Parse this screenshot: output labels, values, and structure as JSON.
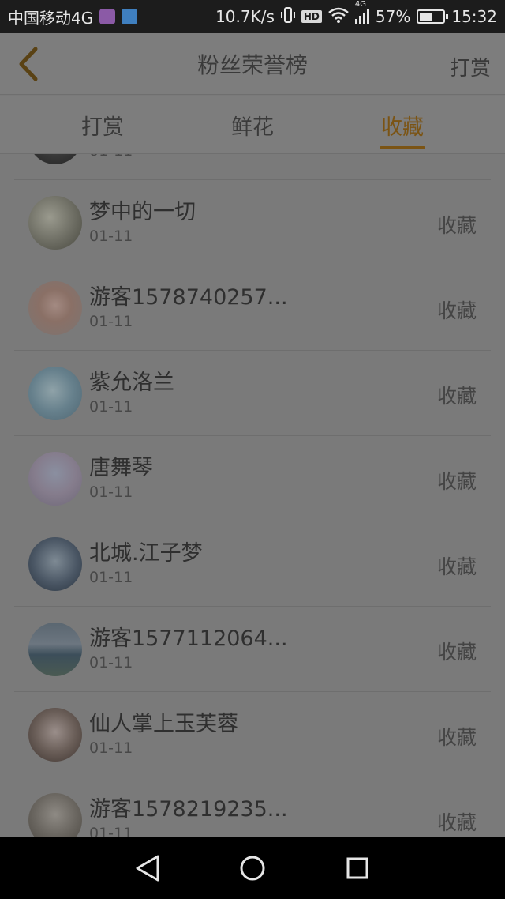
{
  "status_bar": {
    "carrier": "中国移动4G",
    "speed": "10.7K/s",
    "hd": "HD",
    "network": "4G",
    "battery": "57%",
    "battery_level": 0.57,
    "time": "15:32"
  },
  "header": {
    "title": "粉丝荣誉榜",
    "right_action": "打赏"
  },
  "tabs": [
    {
      "label": "打赏",
      "active": false
    },
    {
      "label": "鲜花",
      "active": false
    },
    {
      "label": "收藏",
      "active": true
    }
  ],
  "list": {
    "partial_top_date": "01-11",
    "items": [
      {
        "name": "梦中的一切",
        "date": "01-11",
        "action": "收藏"
      },
      {
        "name": "游客1578740257...",
        "date": "01-11",
        "action": "收藏"
      },
      {
        "name": "紫允洛兰",
        "date": "01-11",
        "action": "收藏"
      },
      {
        "name": "唐舞琴",
        "date": "01-11",
        "action": "收藏"
      },
      {
        "name": "北城.江子梦",
        "date": "01-11",
        "action": "收藏"
      },
      {
        "name": "游客1577112064...",
        "date": "01-11",
        "action": "收藏"
      },
      {
        "name": "仙人掌上玉芙蓉",
        "date": "01-11",
        "action": "收藏"
      },
      {
        "name": "游客1578219235...",
        "date": "01-11",
        "action": "收藏"
      }
    ]
  },
  "colors": {
    "accent": "#7b5414",
    "overlay_background": "#7a7a7a"
  }
}
